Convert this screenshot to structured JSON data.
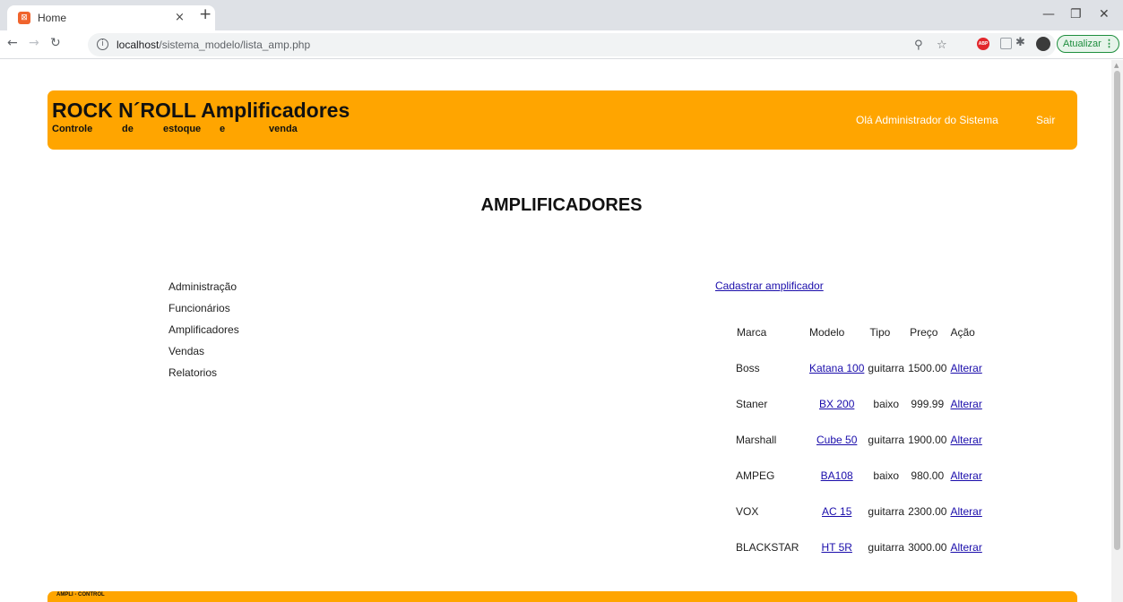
{
  "browser": {
    "tab_title": "Home",
    "tab_close": "×",
    "new_tab": "+",
    "url_host": "localhost",
    "url_path": "/sistema_modelo/lista_amp.php",
    "update_label": "Atualizar",
    "update_menu": "⋮",
    "favicon_text": "⊠",
    "icons": [
      "back-arrow-icon",
      "forward-arrow-icon",
      "reload-icon",
      "info-icon",
      "zoom-icon",
      "star-icon",
      "adblock-icon",
      "extension-icon",
      "puzzle-icon",
      "avatar"
    ]
  },
  "header": {
    "title": "ROCK N´ROLL Amplificadores",
    "subtitle_words": [
      "Controle",
      "de",
      "estoque",
      "e",
      "venda"
    ],
    "greeting": "Olá Administrador do Sistema",
    "logout": "Sair",
    "background": "#ffa500"
  },
  "page_title": "AMPLIFICADORES",
  "menu": {
    "items": [
      "Administração",
      "Funcionários",
      "Amplificadores",
      "Vendas",
      "Relatorios"
    ]
  },
  "register_link": "Cadastrar amplificador",
  "table": {
    "headers": [
      "Marca",
      "Modelo",
      "Tipo",
      "Preço",
      "Ação"
    ],
    "rows": [
      {
        "marca": "Boss",
        "modelo": "Katana 100",
        "tipo": "guitarra",
        "preco": "1500.00",
        "acao": "Alterar"
      },
      {
        "marca": "Staner",
        "modelo": "BX 200",
        "tipo": "baixo",
        "preco": "999.99",
        "acao": "Alterar"
      },
      {
        "marca": "Marshall",
        "modelo": "Cube 50",
        "tipo": "guitarra",
        "preco": "1900.00",
        "acao": "Alterar"
      },
      {
        "marca": "AMPEG",
        "modelo": "BA108",
        "tipo": "baixo",
        "preco": "980.00",
        "acao": "Alterar"
      },
      {
        "marca": "VOX",
        "modelo": "AC 15",
        "tipo": "guitarra",
        "preco": "2300.00",
        "acao": "Alterar"
      },
      {
        "marca": "BLACKSTAR",
        "modelo": "HT 5R",
        "tipo": "guitarra",
        "preco": "3000.00",
        "acao": "Alterar"
      }
    ]
  },
  "footer": {
    "text": "AMPLI - CONTROL"
  }
}
